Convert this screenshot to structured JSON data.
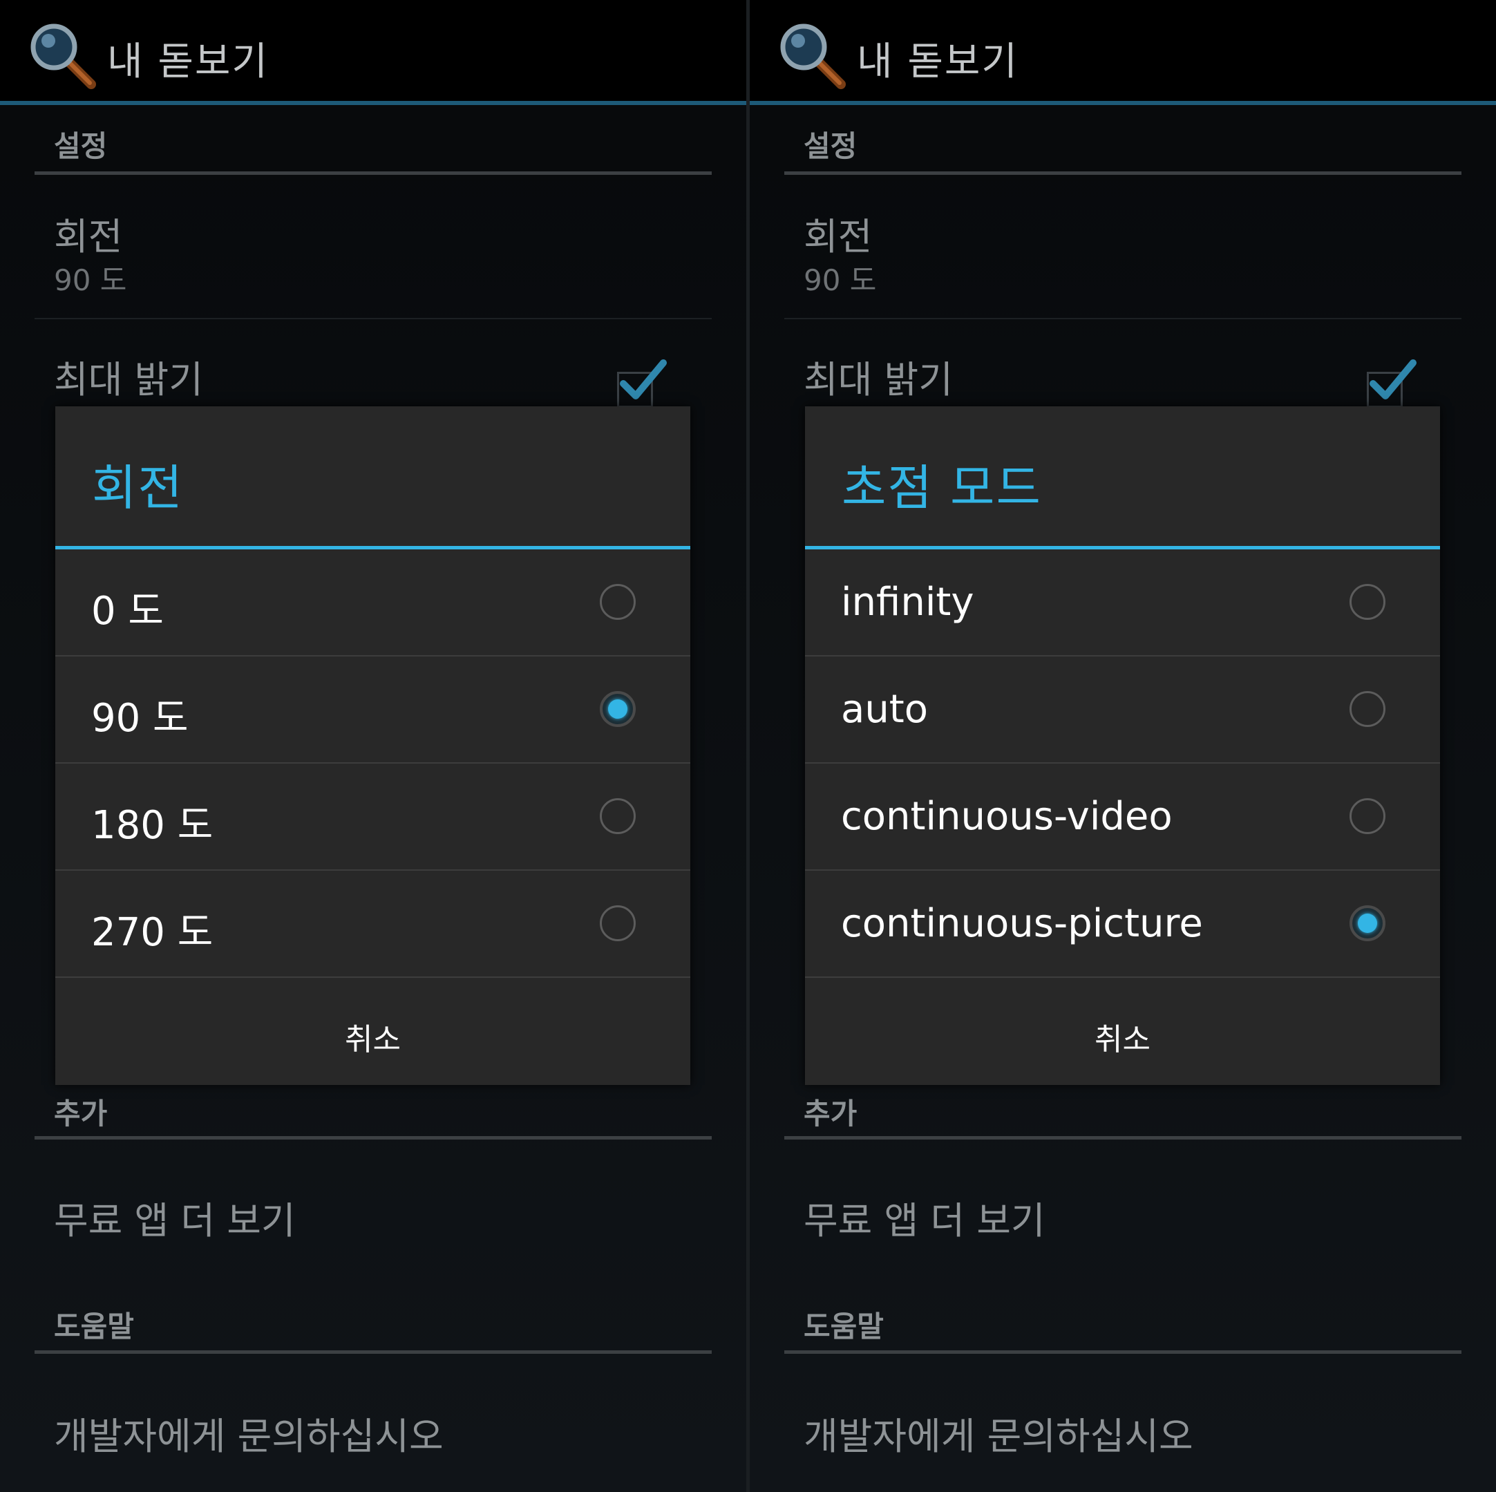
{
  "colors": {
    "accent": "#33b5e5",
    "dialog_bg": "#282828",
    "action_bar_line": "#1d5a78"
  },
  "screens": [
    {
      "app_title": "내 돋보기",
      "settings_header": "설정",
      "rotation_title": "회전",
      "rotation_summary": "90 도",
      "max_brightness_title": "최대 밝기",
      "max_brightness_checked": true,
      "extra_header": "추가",
      "more_apps": "무료 앱 더 보기",
      "help_header": "도움말",
      "contact": "개발자에게 문의하십시오",
      "dialog": {
        "title": "회전",
        "options": [
          {
            "label": "0 도",
            "selected": false
          },
          {
            "label": "90 도",
            "selected": true
          },
          {
            "label": "180 도",
            "selected": false
          },
          {
            "label": "270 도",
            "selected": false
          }
        ],
        "cancel": "취소"
      }
    },
    {
      "app_title": "내 돋보기",
      "settings_header": "설정",
      "rotation_title": "회전",
      "rotation_summary": "90 도",
      "max_brightness_title": "최대 밝기",
      "max_brightness_checked": true,
      "extra_header": "추가",
      "more_apps": "무료 앱 더 보기",
      "help_header": "도움말",
      "contact": "개발자에게 문의하십시오",
      "dialog": {
        "title": "초점 모드",
        "options": [
          {
            "label": "infinity",
            "selected": false
          },
          {
            "label": "auto",
            "selected": false
          },
          {
            "label": "continuous-video",
            "selected": false
          },
          {
            "label": "continuous-picture",
            "selected": true
          }
        ],
        "cancel": "취소"
      }
    }
  ]
}
